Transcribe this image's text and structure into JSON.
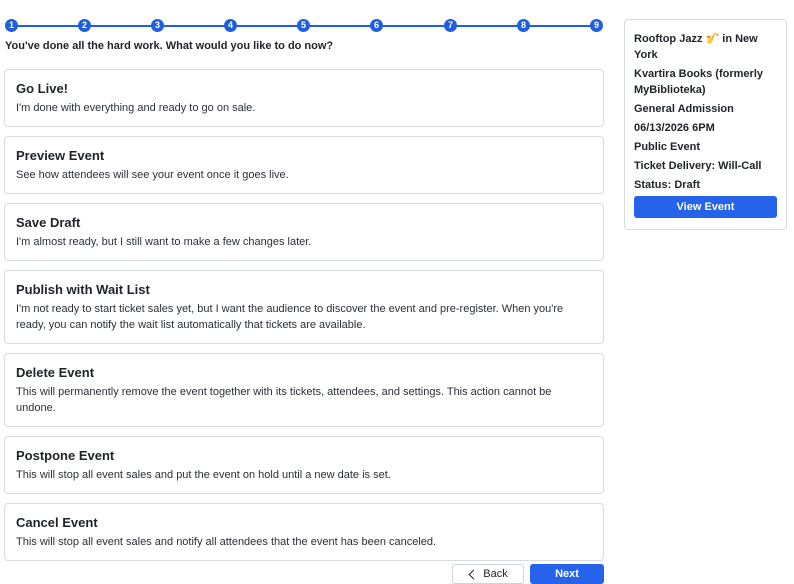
{
  "stepper": {
    "steps": [
      "1",
      "2",
      "3",
      "4",
      "5",
      "6",
      "7",
      "8",
      "9"
    ],
    "current": 9
  },
  "prompt": "You've done all the hard work. What would you like to do now?",
  "options": [
    {
      "title": "Go Live!",
      "desc": "I'm done with everything and ready to go on sale."
    },
    {
      "title": "Preview Event",
      "desc": "See how attendees will see your event once it goes live."
    },
    {
      "title": "Save Draft",
      "desc": "I'm almost ready, but I still want to make a few changes later."
    },
    {
      "title": "Publish with Wait List",
      "desc": "I'm not ready to start ticket sales yet, but I want the audience to discover the event and pre-register. When you're ready, you can notify the wait list automatically that tickets are available."
    },
    {
      "title": "Delete Event",
      "desc": "This will permanently remove the event together with its tickets, attendees, and settings. This action cannot be undone."
    },
    {
      "title": "Postpone Event",
      "desc": "This will stop all event sales and put the event on hold until a new date is set."
    },
    {
      "title": "Cancel Event",
      "desc": "This will stop all event sales and notify all attendees that the event has been canceled."
    }
  ],
  "footer": {
    "back_label": "Back",
    "next_label": "Next"
  },
  "sidebar": {
    "event_name_prefix": "Rooftop Jazz ",
    "event_name_emoji": "🎷",
    "event_name_suffix": " in New York",
    "venue": "Kvartira Books (formerly MyBiblioteka)",
    "ticket_type": "General Admission",
    "datetime": "06/13/2026 6PM",
    "visibility": "Public Event",
    "delivery": "Ticket Delivery: Will-Call",
    "status": "Status: Draft",
    "view_label": "View Event"
  },
  "colors": {
    "accent": "#2563eb",
    "stepper": "#1f5fdc",
    "border": "#d7dbe0"
  },
  "icons": {
    "back": "chevron-left-icon"
  }
}
